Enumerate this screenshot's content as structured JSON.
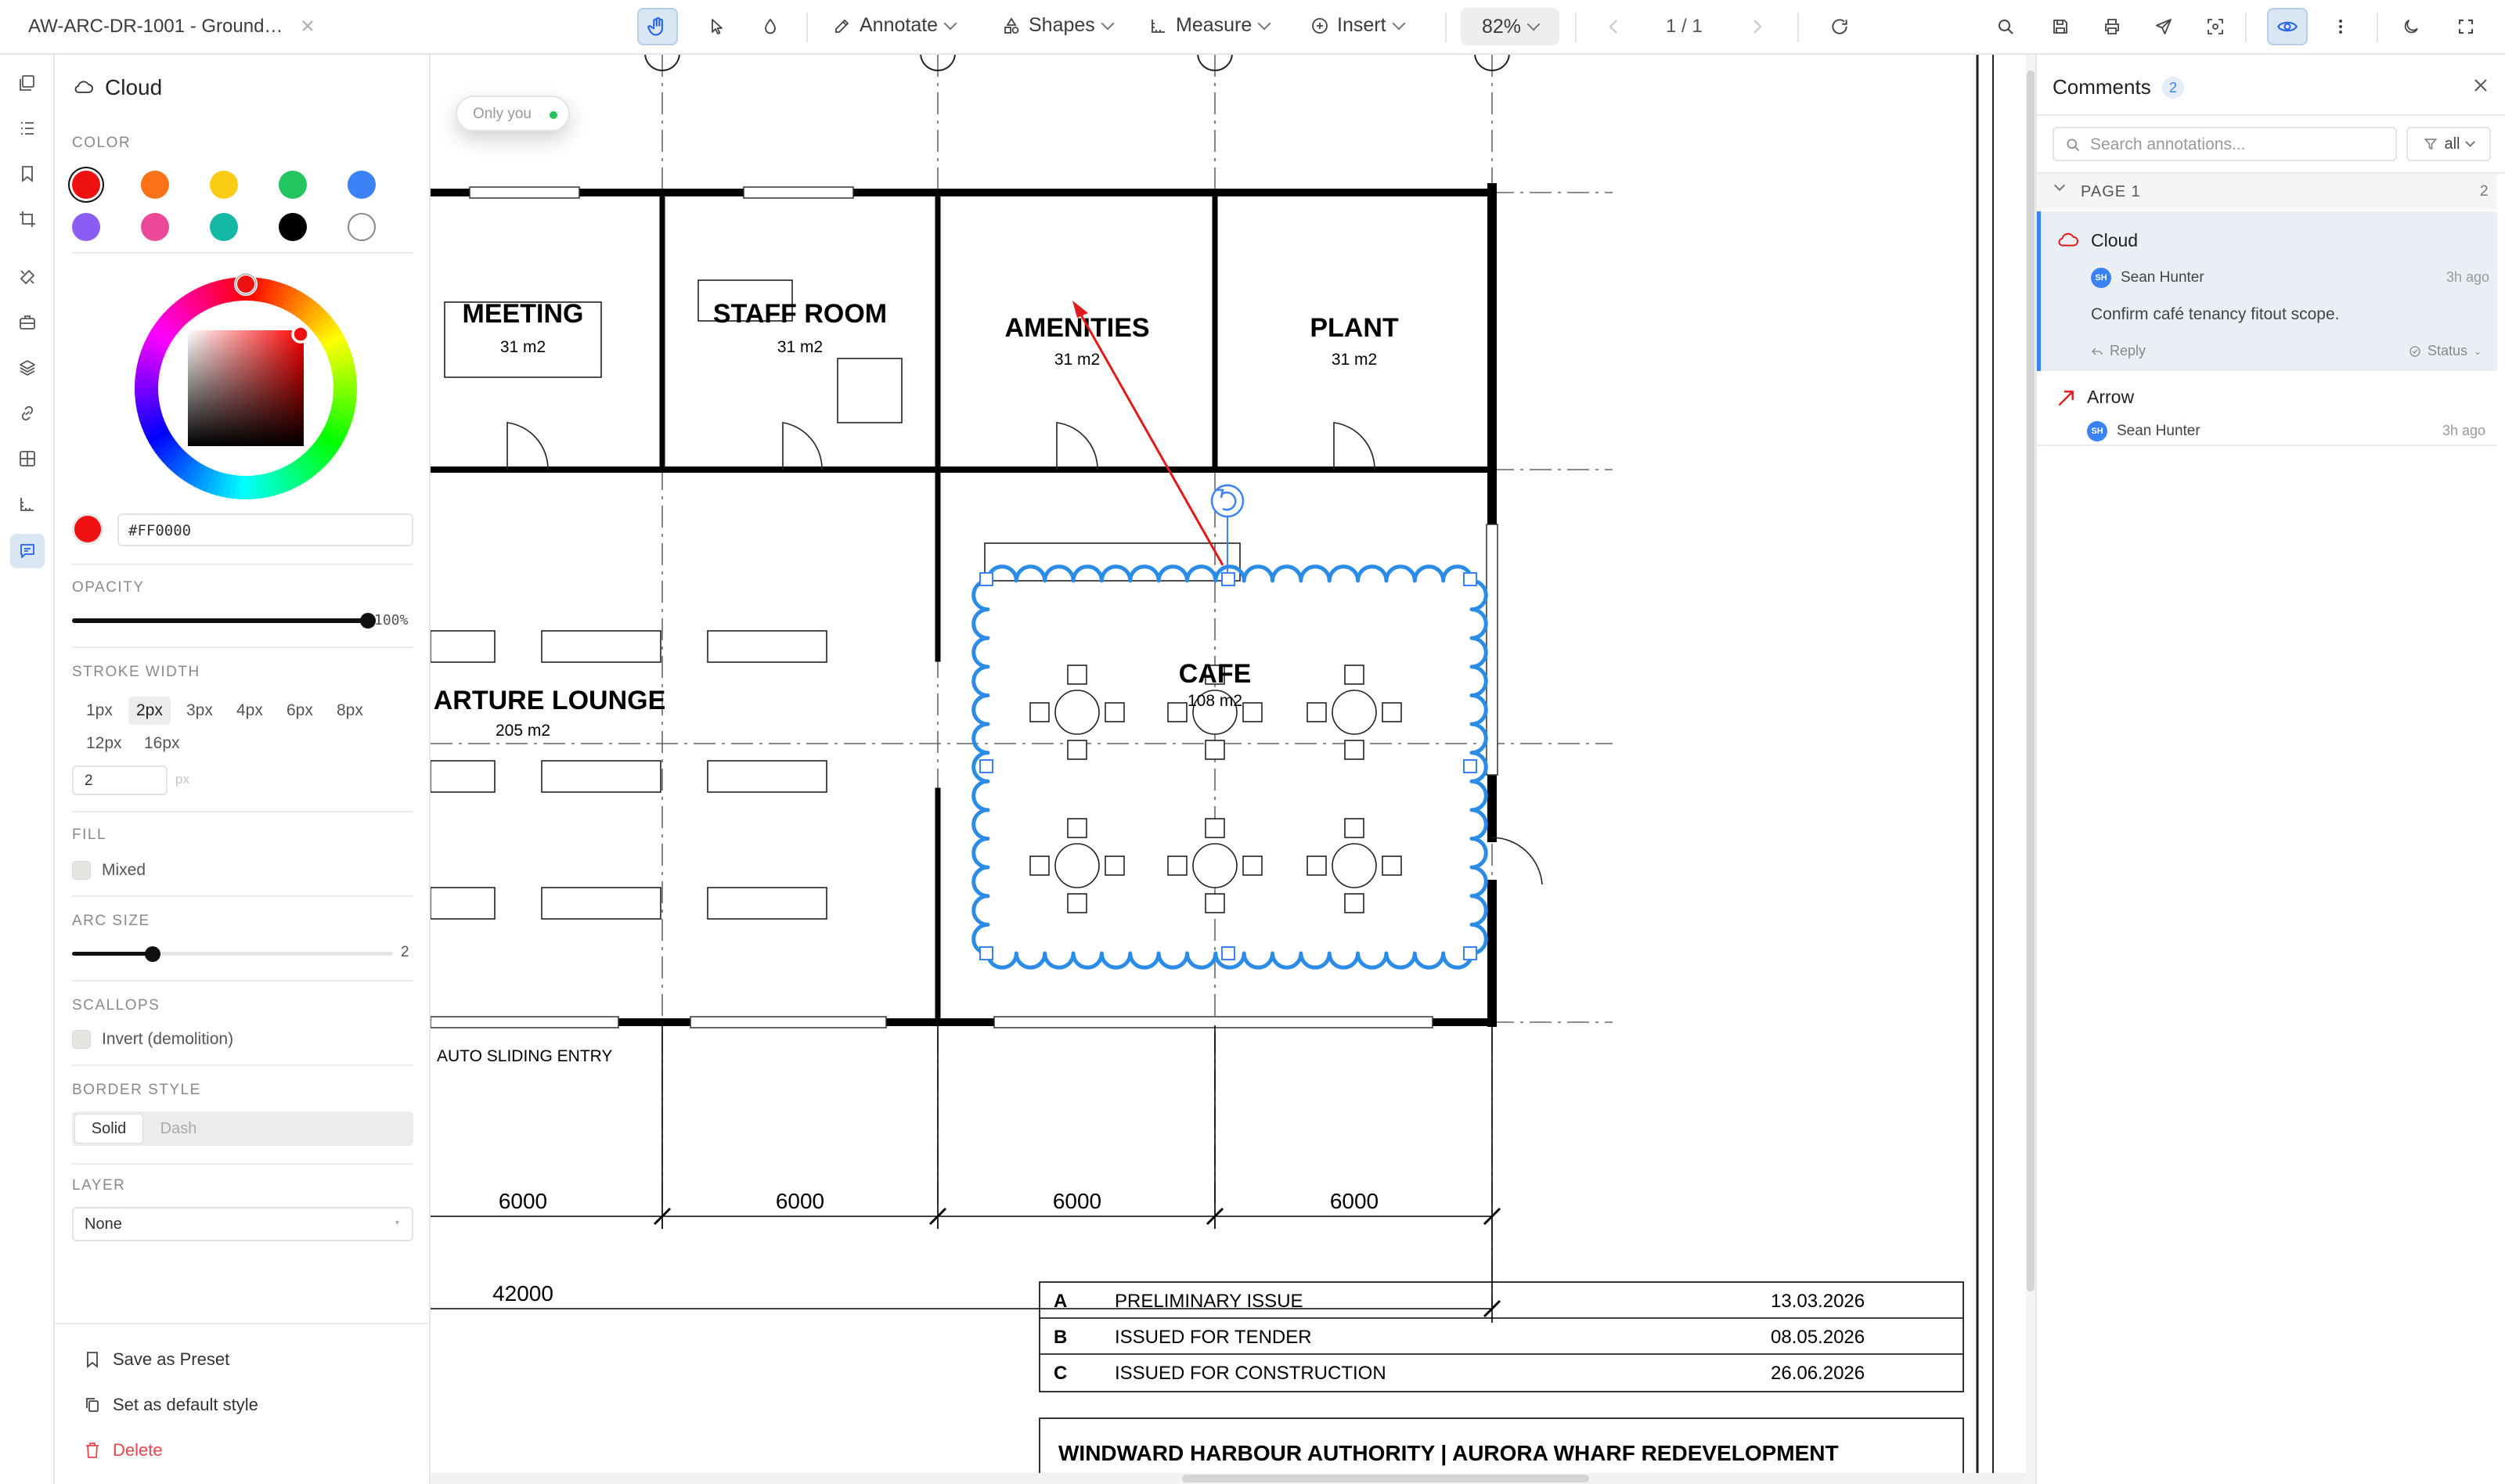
{
  "app": {
    "document_title": "AW-ARC-DR-1001 - Ground…"
  },
  "toolbar": {
    "annotate_label": "Annotate",
    "shapes_label": "Shapes",
    "measure_label": "Measure",
    "insert_label": "Insert",
    "zoom_label": "82%",
    "page_indicator": "1 / 1",
    "accent_color": "#3b82f6",
    "active_tool": "pan"
  },
  "rail": {
    "icons": [
      "thumbnails-icon",
      "outline-icon",
      "bookmark-icon",
      "crop-icon",
      "tools-icon",
      "briefcase-icon",
      "layers-icon",
      "link-icon",
      "grid-icon",
      "measure-icon",
      "comment-icon"
    ],
    "active": "comment-icon"
  },
  "panel": {
    "title": "Cloud",
    "color_label": "COLOR",
    "swatches": [
      "#ef1111",
      "#f97316",
      "#facc15",
      "#22c55e",
      "#3b82f6",
      "#8b5cf6",
      "#ec4899",
      "#14b8a6",
      "#000000",
      "#ffffff"
    ],
    "selected_swatch": "#ef1111",
    "hex_value": "#FF0000",
    "opacity_label": "OPACITY",
    "opacity_value": "100%",
    "opacity_fraction": 1.0,
    "stroke_label": "STROKE WIDTH",
    "stroke_options": [
      "1px",
      "2px",
      "3px",
      "4px",
      "6px",
      "8px",
      "12px",
      "16px"
    ],
    "stroke_selected": "2px",
    "stroke_input": "2",
    "stroke_unit": "px",
    "fill_label": "FILL",
    "fill_option": "Mixed",
    "arc_label": "ARC SIZE",
    "arc_value": "2",
    "arc_fraction": 0.25,
    "scallops_label": "SCALLOPS",
    "scallops_option": "Invert (demolition)",
    "border_label": "BORDER STYLE",
    "border_solid": "Solid",
    "border_dash": "Dash",
    "layer_label": "LAYER",
    "layer_value": "None",
    "save_preset": "Save as Preset",
    "set_default": "Set as default style",
    "delete_label": "Delete"
  },
  "canvas": {
    "only_you": "Only you",
    "rooms": {
      "meeting": "MEETING",
      "meeting_area": "31 m2",
      "staff": "STAFF ROOM",
      "staff_area": "31 m2",
      "amenities": "AMENITIES",
      "amenities_area": "31 m2",
      "plant": "PLANT",
      "plant_area": "31 m2",
      "lounge": "ARTURE LOUNGE",
      "lounge_area": "205 m2",
      "cafe": "CAFE",
      "cafe_area": "108 m2"
    },
    "entry_label": "AUTO SLIDING ENTRY",
    "dims": [
      "6000",
      "6000",
      "6000",
      "6000"
    ],
    "total_dim": "42000",
    "revisions": [
      {
        "rev": "A",
        "desc": "PRELIMINARY ISSUE",
        "date": "13.03.2026"
      },
      {
        "rev": "B",
        "desc": "ISSUED FOR TENDER",
        "date": "08.05.2026"
      },
      {
        "rev": "C",
        "desc": "ISSUED FOR CONSTRUCTION",
        "date": "26.06.2026"
      }
    ],
    "title_block": "WINDWARD HARBOUR AUTHORITY | AURORA WHARF REDEVELOPMENT"
  },
  "comments": {
    "title": "Comments",
    "count": "2",
    "search_placeholder": "Search annotations...",
    "filter_label": "all",
    "page_label": "PAGE 1",
    "page_count": "2",
    "items": [
      {
        "type": "Cloud",
        "author": "Sean Hunter",
        "initials": "SH",
        "time": "3h ago",
        "text": "Confirm café tenancy fitout scope.",
        "reply": "Reply",
        "status": "Status"
      },
      {
        "type": "Arrow",
        "author": "Sean Hunter",
        "initials": "SH",
        "time": "3h ago"
      }
    ]
  }
}
